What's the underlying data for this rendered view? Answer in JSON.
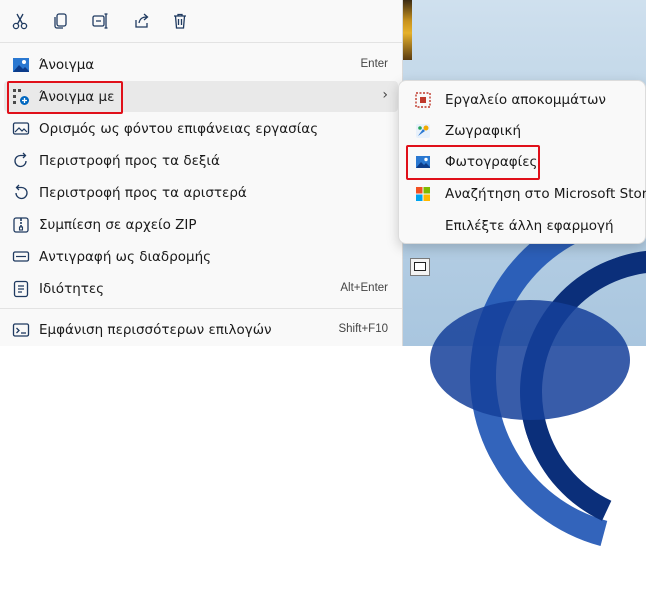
{
  "toolbar": {
    "icons": [
      "cut-icon",
      "copy-icon",
      "rename-icon",
      "share-icon",
      "delete-icon"
    ]
  },
  "menu": {
    "items": [
      {
        "label": "Άνοιγμα",
        "shortcut": "Enter",
        "icon": "photo-icon"
      },
      {
        "label": "Άνοιγμα με",
        "icon": "open-with-icon",
        "has_submenu": true
      },
      {
        "label": "Ορισμός ως φόντου επιφάνειας εργασίας",
        "icon": "wallpaper-icon"
      },
      {
        "label": "Περιστροφή προς τα δεξιά",
        "icon": "rotate-right-icon"
      },
      {
        "label": "Περιστροφή προς τα αριστερά",
        "icon": "rotate-left-icon"
      },
      {
        "label": "Συμπίεση σε αρχείο ZIP",
        "icon": "zip-icon"
      },
      {
        "label": "Αντιγραφή ως διαδρομής",
        "icon": "copy-path-icon"
      },
      {
        "label": "Ιδιότητες",
        "shortcut": "Alt+Enter",
        "icon": "properties-icon"
      },
      {
        "label": "Εμφάνιση περισσότερων επιλογών",
        "shortcut": "Shift+F10",
        "icon": "more-options-icon"
      }
    ],
    "submenu_arrow": "›"
  },
  "submenu": {
    "items": [
      {
        "label": "Εργαλείο αποκομμάτων",
        "icon": "snipping-tool-icon"
      },
      {
        "label": "Ζωγραφική",
        "icon": "paint-icon"
      },
      {
        "label": "Φωτογραφίες",
        "icon": "photos-app-icon"
      },
      {
        "label": "Αναζήτηση στο Microsoft Store",
        "icon": "store-icon"
      },
      {
        "label": "Επιλέξτε άλλη εφαρμογή",
        "icon": ""
      }
    ]
  },
  "colors": {
    "highlight_box": "#e0101a",
    "accent": "#0067c0"
  }
}
